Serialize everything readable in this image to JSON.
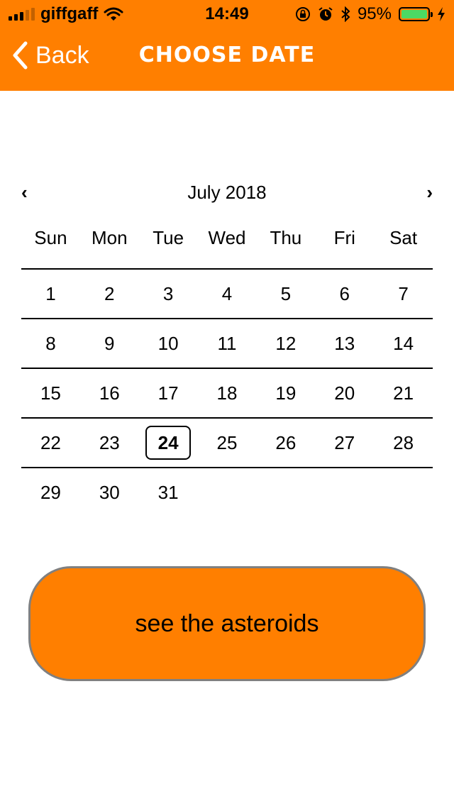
{
  "status_bar": {
    "carrier": "giffgaff",
    "time": "14:49",
    "battery": "95%",
    "battery_level": 0.95,
    "icons": [
      "signal-bars-icon",
      "wifi-icon",
      "orientation-lock-icon",
      "alarm-icon",
      "bluetooth-icon",
      "battery-icon",
      "charging-bolt-icon"
    ]
  },
  "nav": {
    "back_label": "Back",
    "title": "CHOOSE DATE"
  },
  "calendar": {
    "month_label": "July 2018",
    "prev_symbol": "‹",
    "next_symbol": "›",
    "weekdays": [
      "Sun",
      "Mon",
      "Tue",
      "Wed",
      "Thu",
      "Fri",
      "Sat"
    ],
    "weeks": [
      [
        "1",
        "2",
        "3",
        "4",
        "5",
        "6",
        "7"
      ],
      [
        "8",
        "9",
        "10",
        "11",
        "12",
        "13",
        "14"
      ],
      [
        "15",
        "16",
        "17",
        "18",
        "19",
        "20",
        "21"
      ],
      [
        "22",
        "23",
        "24",
        "25",
        "26",
        "27",
        "28"
      ],
      [
        "29",
        "30",
        "31",
        "",
        "",
        "",
        ""
      ]
    ],
    "selected_day": "24"
  },
  "action": {
    "label": "see the asteroids"
  },
  "colors": {
    "accent": "#ff7f00",
    "button_border": "#808080",
    "battery_fill": "#4cd964"
  }
}
